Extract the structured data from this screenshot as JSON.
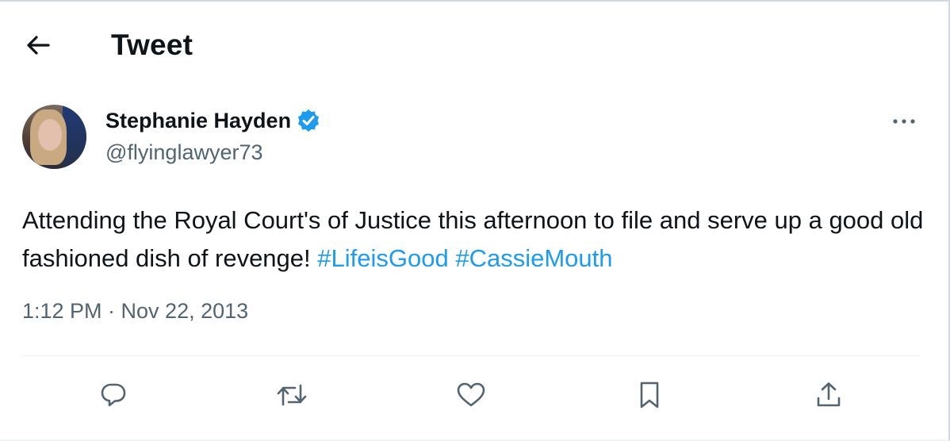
{
  "header": {
    "title": "Tweet",
    "back_icon": "arrow-left-icon"
  },
  "tweet": {
    "author": {
      "name": "Stephanie Hayden",
      "handle": "@flyinglawyer73",
      "verified": true,
      "verified_color": "#1d9bf0"
    },
    "text_parts": [
      {
        "text": "Attending the Royal Court's of Justice this afternoon to file and serve up a good old fashioned dish of revenge! ",
        "type": "plain"
      },
      {
        "text": "#LifeisGood",
        "type": "hashtag"
      },
      {
        "text": " ",
        "type": "plain"
      },
      {
        "text": "#CassieMouth",
        "type": "hashtag"
      }
    ],
    "timestamp": "1:12 PM · Nov 22, 2013"
  },
  "actions": [
    {
      "name": "reply",
      "icon": "reply-icon"
    },
    {
      "name": "retweet",
      "icon": "retweet-icon"
    },
    {
      "name": "like",
      "icon": "heart-icon"
    },
    {
      "name": "bookmark",
      "icon": "bookmark-icon"
    },
    {
      "name": "share",
      "icon": "share-icon"
    }
  ],
  "colors": {
    "accent": "#1d9bf0",
    "text": "#0f1419",
    "secondary": "#536471"
  }
}
